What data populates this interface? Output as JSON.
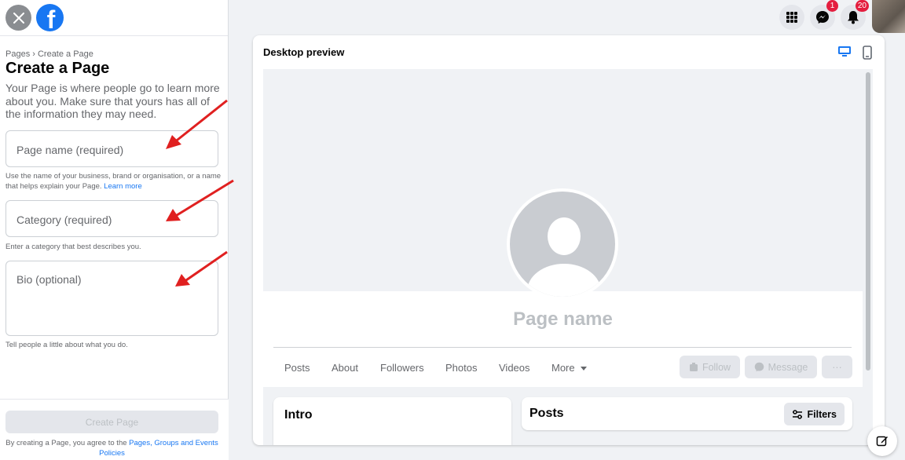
{
  "left_panel": {
    "breadcrumb": "Pages › Create a Page",
    "title": "Create a Page",
    "intro": "Your Page is where people go to learn more about you. Make sure that yours has all of the information they may need.",
    "page_name": {
      "placeholder": "Page name (required)",
      "value": ""
    },
    "page_name_hint": "Use the name of your business, brand or organisation, or a name that helps explain your Page.",
    "learn_more": "Learn more",
    "category": {
      "placeholder": "Category (required)",
      "value": ""
    },
    "category_hint": "Enter a category that best describes you.",
    "bio": {
      "placeholder": "Bio (optional)",
      "value": ""
    },
    "bio_hint": "Tell people a little about what you do.",
    "create_button": "Create Page",
    "terms_prefix": "By creating a Page, you agree to the",
    "terms_link": "Pages, Groups and Events Policies"
  },
  "top_bar": {
    "messenger_badge": "1",
    "notifications_badge": "20"
  },
  "preview": {
    "title": "Desktop preview",
    "page_name": "Page name",
    "tabs": [
      "Posts",
      "About",
      "Followers",
      "Photos",
      "Videos",
      "More"
    ],
    "actions": {
      "follow": "Follow",
      "message": "Message",
      "more": "···"
    },
    "intro_title": "Intro",
    "posts_title": "Posts",
    "filters": "Filters"
  },
  "colors": {
    "brand": "#1877f2",
    "annotation_arrow": "#e02020",
    "badge": "#e41e3f"
  }
}
